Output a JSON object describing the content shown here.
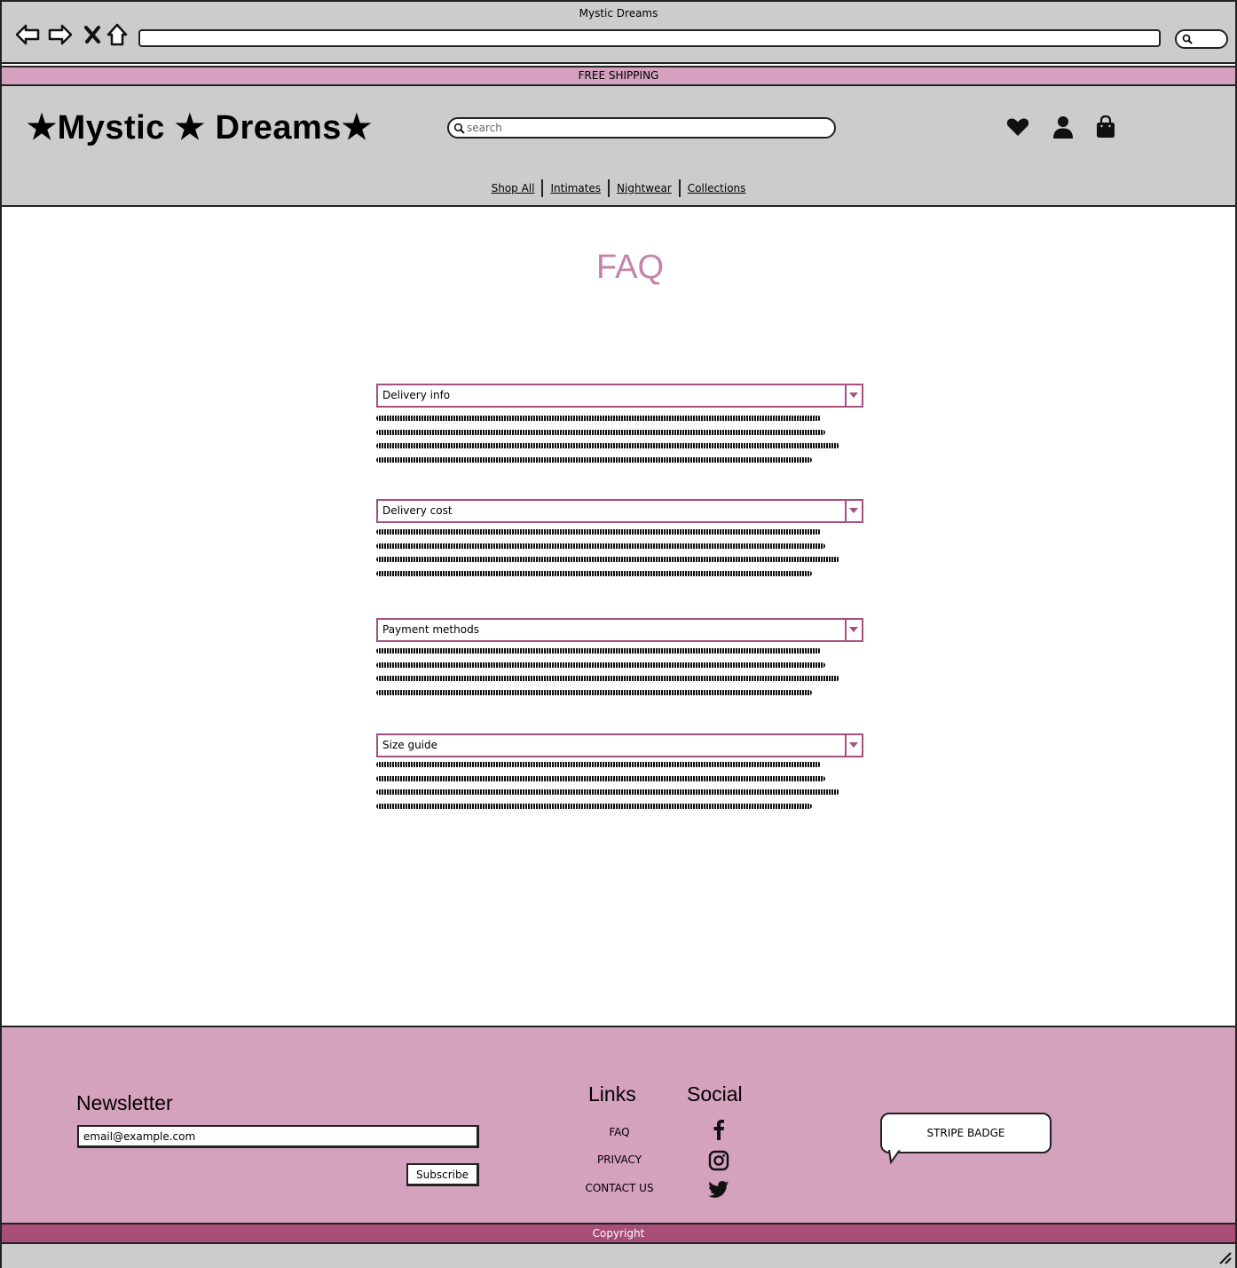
{
  "window": {
    "title": "Mystic Dreams"
  },
  "banner": {
    "text": "FREE SHIPPING"
  },
  "header": {
    "logo": "★Mystic ★ Dreams★",
    "search_placeholder": "search",
    "nav": [
      "Shop All",
      "Intimates",
      "Nightwear",
      "Collections"
    ],
    "icons": [
      "heart-icon",
      "user-icon",
      "shopping-bag-icon"
    ]
  },
  "main": {
    "title": "FAQ",
    "faq": [
      {
        "question": "Delivery info"
      },
      {
        "question": "Delivery cost"
      },
      {
        "question": "Payment methods"
      },
      {
        "question": "Size guide"
      }
    ]
  },
  "footer": {
    "newsletter_title": "Newsletter",
    "email_value": "email@example.com",
    "subscribe_label": "Subscribe",
    "links_title": "Links",
    "links": [
      "FAQ",
      "PRIVACY",
      "CONTACT US"
    ],
    "social_title": "Social",
    "social_icons": [
      "facebook-icon",
      "instagram-icon",
      "twitter-icon"
    ],
    "stripe_badge": "STRIPE BADGE",
    "copyright": "Copyright"
  },
  "colors": {
    "accent_pink": "#d4a0bd",
    "faq_title": "#c583a8",
    "faq_border": "#a84e80",
    "copyright_bar": "#a84e78",
    "chrome_gray": "#cccccc"
  }
}
